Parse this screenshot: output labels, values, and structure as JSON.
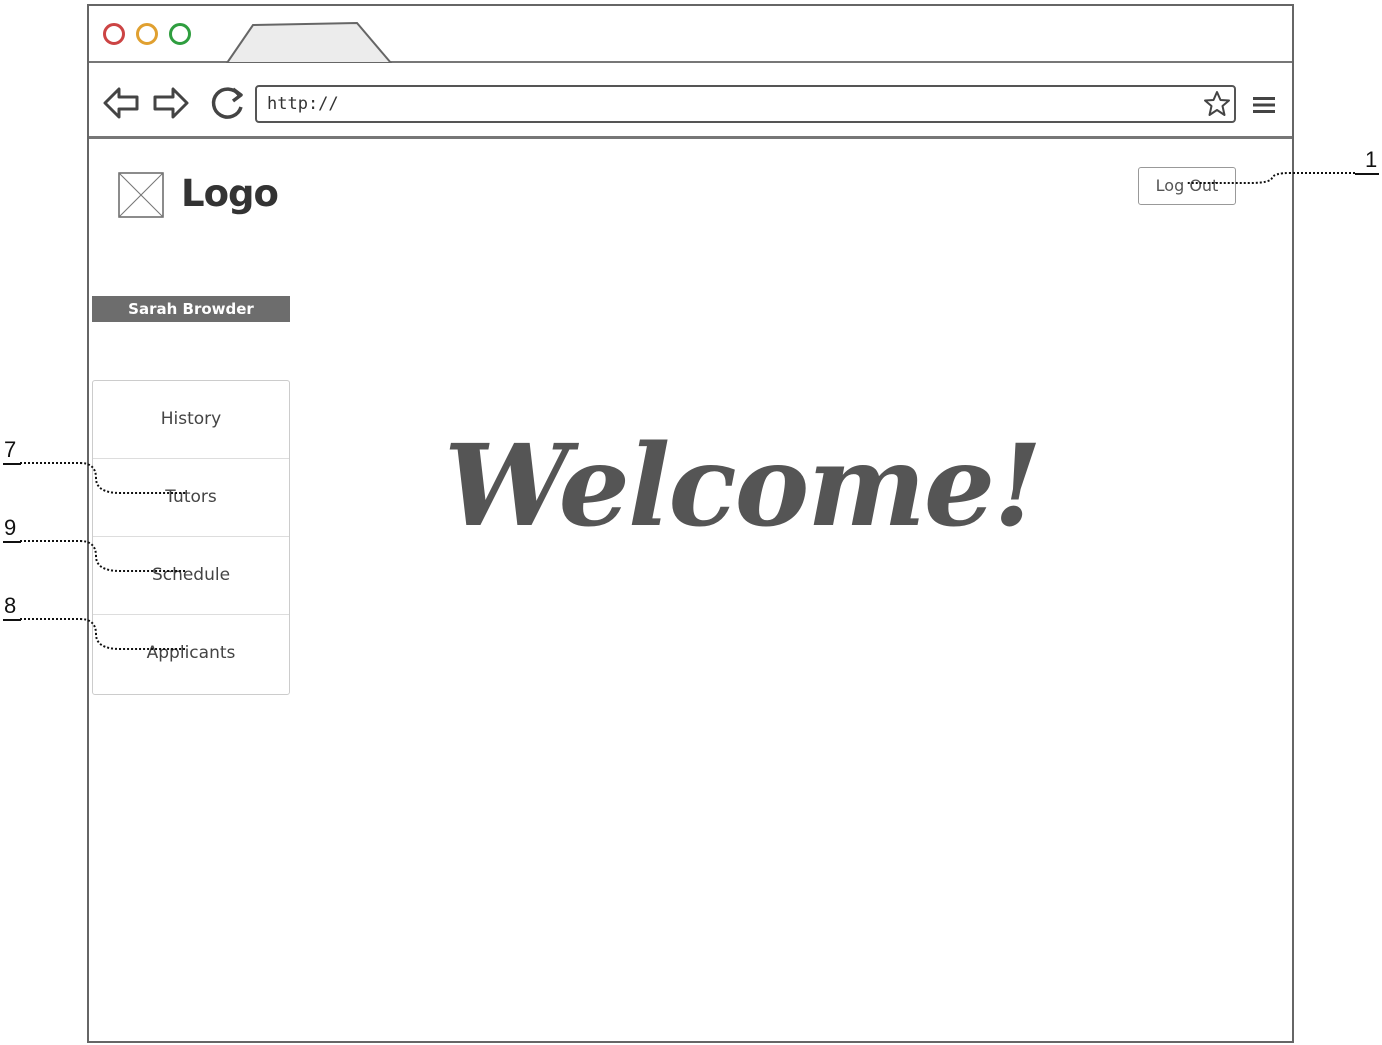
{
  "browser": {
    "url": "http://",
    "window_buttons": [
      {
        "name": "close",
        "color": "#cc4444"
      },
      {
        "name": "minimize",
        "color": "#e0a030"
      },
      {
        "name": "maximize",
        "color": "#2f9e3f"
      }
    ]
  },
  "header": {
    "logo_text": "Logo",
    "logout_label": "Log Out"
  },
  "sidebar": {
    "user_name": "Sarah Browder",
    "items": [
      {
        "label": "History"
      },
      {
        "label": "Tutors"
      },
      {
        "label": "Schedule"
      },
      {
        "label": "Applicants"
      }
    ]
  },
  "main": {
    "welcome_text": "Welcome!"
  },
  "annotations": [
    "1",
    "7",
    "9",
    "8"
  ]
}
